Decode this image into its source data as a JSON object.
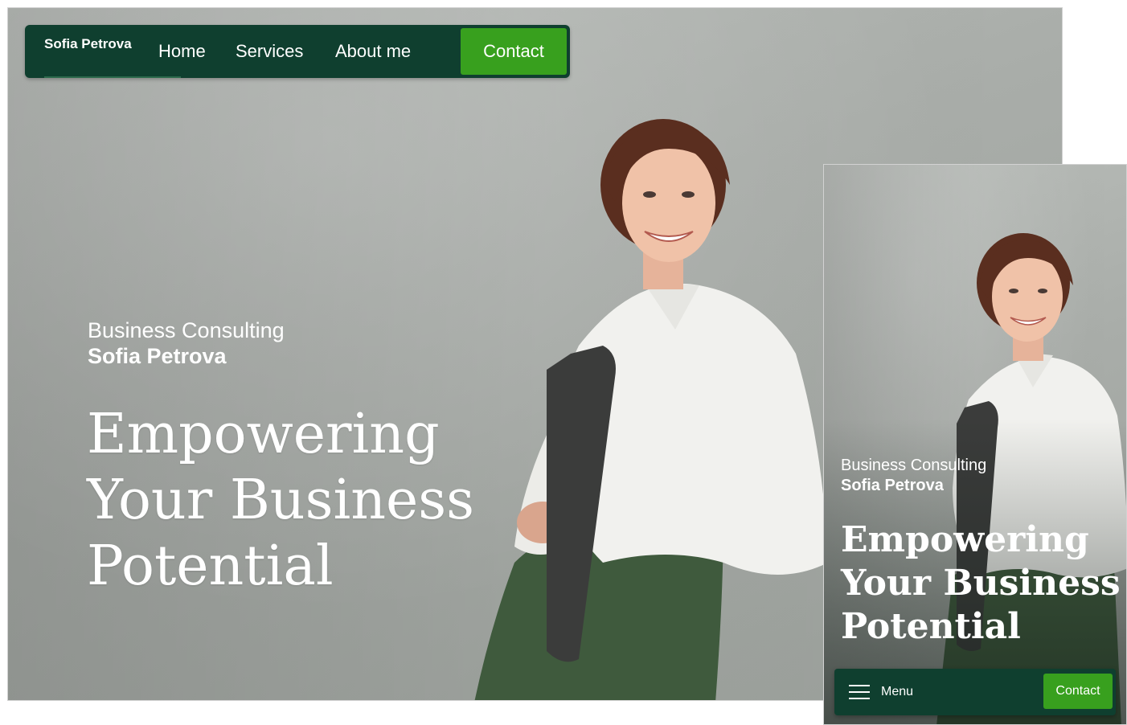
{
  "desktop": {
    "nav": {
      "brand": "Sofia Petrova",
      "links": [
        "Home",
        "Services",
        "About me"
      ],
      "contact": "Contact"
    },
    "hero": {
      "subtitle": "Business Consulting",
      "name": "Sofia Petrova",
      "title": "Empowering Your Business Potential"
    }
  },
  "mobile": {
    "hero": {
      "subtitle": "Business Consulting",
      "name": "Sofia Petrova",
      "title": "Empowering Your Business Potential"
    },
    "bar": {
      "menu_label": "Menu",
      "contact": "Contact"
    }
  },
  "colors": {
    "nav_bg": "#0f3f2f",
    "accent": "#38a01e",
    "text": "#ffffff"
  },
  "icons": [
    "hamburger-icon"
  ]
}
